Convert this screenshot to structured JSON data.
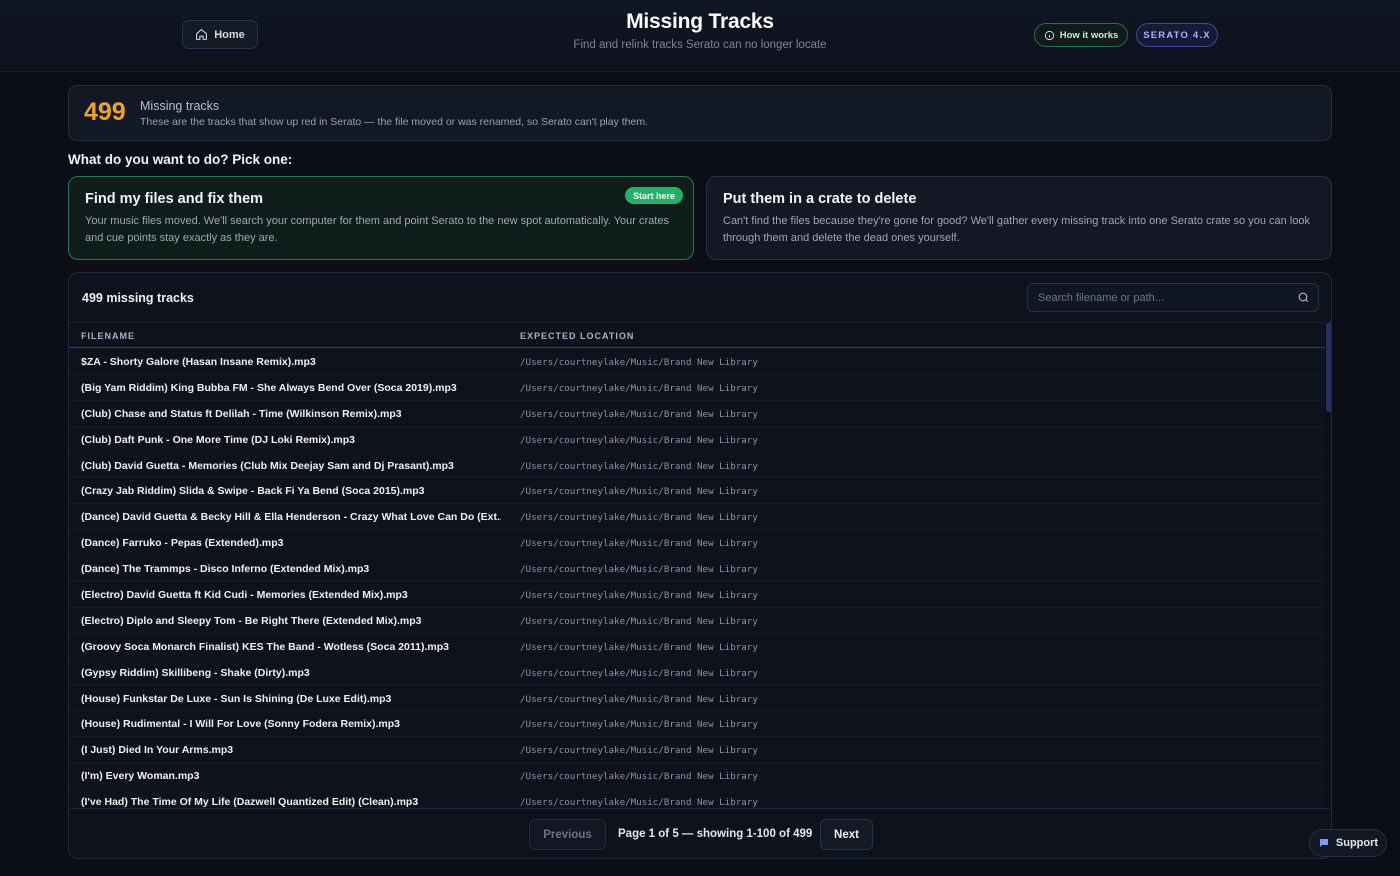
{
  "header": {
    "home_label": "Home",
    "title": "Missing Tracks",
    "subtitle": "Find and relink tracks Serato can no longer locate",
    "how_label": "How it works",
    "version_badge": "SERATO 4.X"
  },
  "summary": {
    "count": "499",
    "label": "Missing tracks",
    "description": "These are the tracks that show up red in Serato — the file moved or was renamed, so Serato can't play them."
  },
  "prompt": "What do you want to do? Pick one:",
  "options": {
    "fix": {
      "title": "Find my files and fix them",
      "badge": "Start here",
      "description": "Your music files moved. We'll search your computer for them and point Serato to the new spot automatically. Your crates and cue points stay exactly as they are."
    },
    "delete": {
      "title": "Put them in a crate to delete",
      "description": "Can't find the files because they're gone for good? We'll gather every missing track into one Serato crate so you can look through them and delete the dead ones yourself."
    }
  },
  "table": {
    "title": "499 missing tracks",
    "search_placeholder": "Search filename or path...",
    "columns": [
      "FILENAME",
      "EXPECTED LOCATION"
    ],
    "rows": [
      {
        "filename": "$ZA - Shorty Galore (Hasan Insane Remix).mp3",
        "location": "/Users/courtneylake/Music/Brand New Library"
      },
      {
        "filename": "(Big Yam Riddim) King Bubba FM - She Always Bend Over (Soca 2019).mp3",
        "location": "/Users/courtneylake/Music/Brand New Library"
      },
      {
        "filename": "(Club) Chase and Status ft Delilah - Time (Wilkinson Remix).mp3",
        "location": "/Users/courtneylake/Music/Brand New Library"
      },
      {
        "filename": "(Club) Daft Punk - One More Time (DJ Loki Remix).mp3",
        "location": "/Users/courtneylake/Music/Brand New Library"
      },
      {
        "filename": "(Club) David Guetta - Memories (Club Mix Deejay Sam and Dj Prasant).mp3",
        "location": "/Users/courtneylake/Music/Brand New Library"
      },
      {
        "filename": "(Crazy Jab Riddim) Slida & Swipe - Back Fi Ya Bend (Soca 2015).mp3",
        "location": "/Users/courtneylake/Music/Brand New Library"
      },
      {
        "filename": "(Dance) David Guetta & Becky Hill & Ella Henderson - Crazy What Love Can Do (Ext...",
        "location": "/Users/courtneylake/Music/Brand New Library"
      },
      {
        "filename": "(Dance) Farruko - Pepas (Extended).mp3",
        "location": "/Users/courtneylake/Music/Brand New Library"
      },
      {
        "filename": "(Dance) The Trammps - Disco Inferno (Extended Mix).mp3",
        "location": "/Users/courtneylake/Music/Brand New Library"
      },
      {
        "filename": "(Electro) David Guetta ft Kid Cudi - Memories (Extended Mix).mp3",
        "location": "/Users/courtneylake/Music/Brand New Library"
      },
      {
        "filename": "(Electro) Diplo and Sleepy Tom - Be Right There (Extended Mix).mp3",
        "location": "/Users/courtneylake/Music/Brand New Library"
      },
      {
        "filename": "(Groovy Soca Monarch Finalist) KES The Band - Wotless (Soca 2011).mp3",
        "location": "/Users/courtneylake/Music/Brand New Library"
      },
      {
        "filename": "(Gypsy Riddim) Skillibeng - Shake (Dirty).mp3",
        "location": "/Users/courtneylake/Music/Brand New Library"
      },
      {
        "filename": "(House) Funkstar De Luxe - Sun Is Shining (De Luxe Edit).mp3",
        "location": "/Users/courtneylake/Music/Brand New Library"
      },
      {
        "filename": "(House) Rudimental - I Will For Love (Sonny Fodera Remix).mp3",
        "location": "/Users/courtneylake/Music/Brand New Library"
      },
      {
        "filename": "(I Just) Died In Your Arms.mp3",
        "location": "/Users/courtneylake/Music/Brand New Library"
      },
      {
        "filename": "(I'm) Every Woman.mp3",
        "location": "/Users/courtneylake/Music/Brand New Library"
      },
      {
        "filename": "(I've Had) The Time Of My Life (Dazwell Quantized Edit) (Clean).mp3",
        "location": "/Users/courtneylake/Music/Brand New Library"
      }
    ]
  },
  "pagination": {
    "previous_label": "Previous",
    "info": "Page 1 of 5 — showing 1-100 of 499",
    "next_label": "Next"
  },
  "support_label": "Support",
  "colors": {
    "background": "#0b0e16",
    "accent_orange": "#f0a32a",
    "accent_green": "#1fb36a",
    "accent_blue": "#3c4a8f"
  },
  "icons": {
    "home": "home-icon",
    "info": "info-icon",
    "search": "search-icon",
    "support": "chat-icon"
  }
}
